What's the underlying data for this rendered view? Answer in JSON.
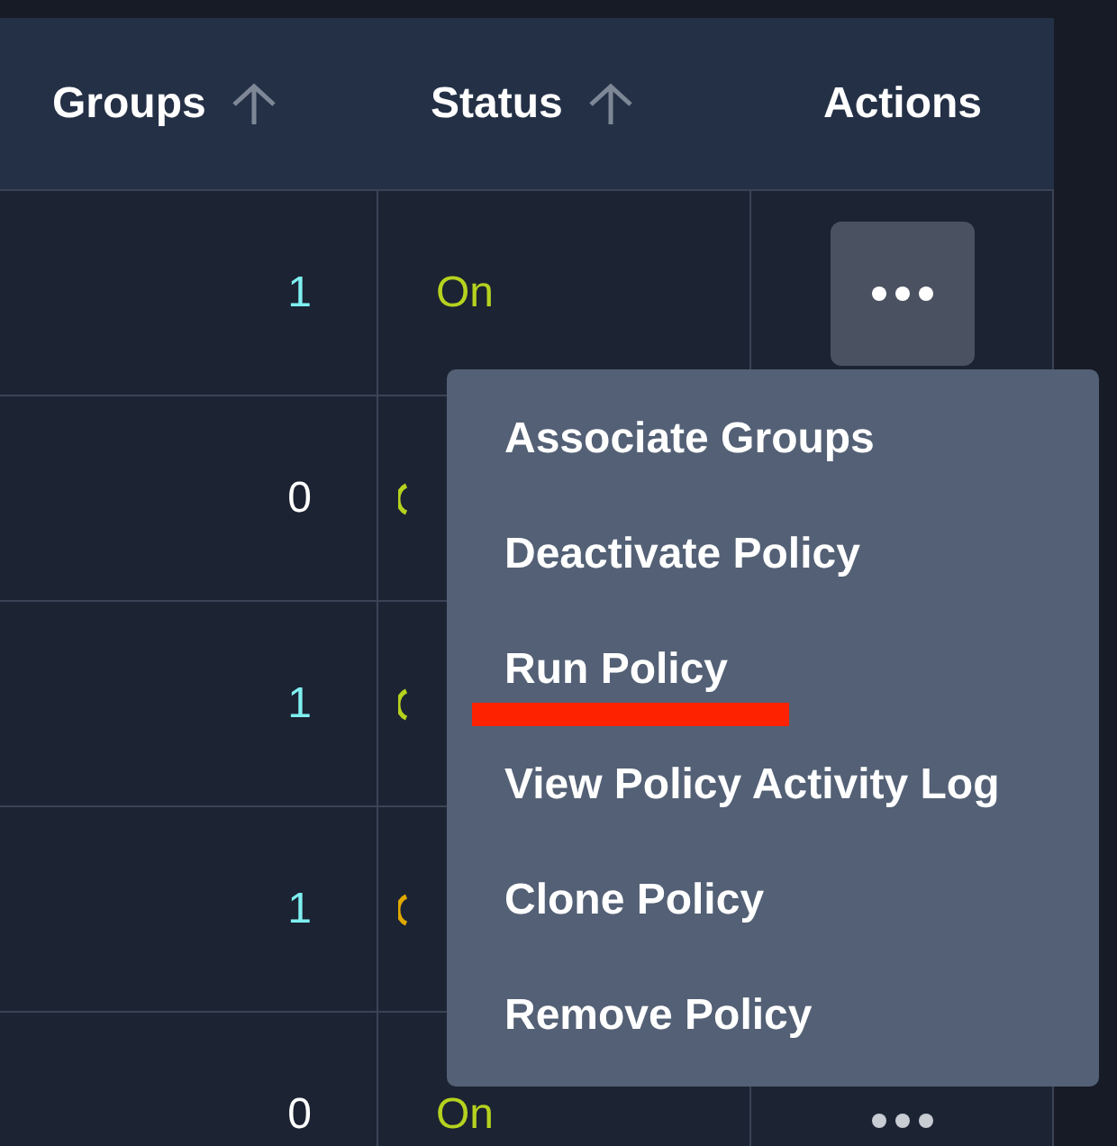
{
  "table": {
    "columns": [
      {
        "label": "Groups",
        "sortable": true
      },
      {
        "label": "Status",
        "sortable": true
      },
      {
        "label": "Actions",
        "sortable": false
      }
    ],
    "rows": [
      {
        "groups": {
          "value": "1",
          "color": "#7ff0f0"
        },
        "status": {
          "label": "On",
          "color": "#b5d21e"
        },
        "menu_open": true
      },
      {
        "groups": {
          "value": "0",
          "color": "#ffffff"
        },
        "status": {
          "color": "#b5d21e"
        }
      },
      {
        "groups": {
          "value": "1",
          "color": "#7ff0f0"
        },
        "status": {
          "color": "#b5d21e"
        }
      },
      {
        "groups": {
          "value": "1",
          "color": "#7ff0f0"
        },
        "status": {
          "color": "#e0a800"
        }
      },
      {
        "groups": {
          "value": "0",
          "color": "#ffffff"
        },
        "status": {
          "label": "On",
          "color": "#b5d21e"
        },
        "menu_open": false
      }
    ]
  },
  "actions_menu": {
    "items": [
      {
        "label": "Associate Groups",
        "underlined": false
      },
      {
        "label": "Deactivate Policy",
        "underlined": false
      },
      {
        "label": "Run Policy",
        "underlined": true
      },
      {
        "label": "View Policy Activity Log",
        "underlined": false
      },
      {
        "label": "Clone Policy",
        "underlined": false
      },
      {
        "label": "Remove Policy",
        "underlined": false
      }
    ]
  }
}
